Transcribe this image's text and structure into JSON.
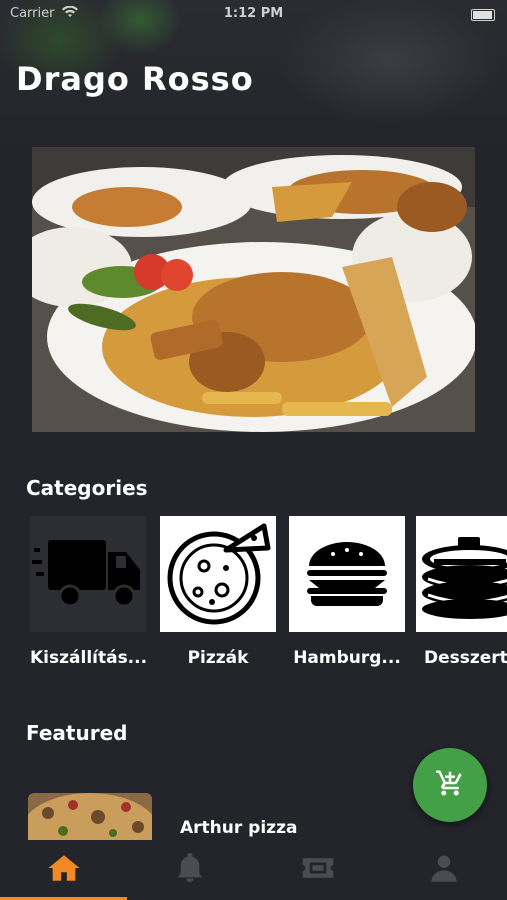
{
  "status_bar": {
    "carrier": "Carrier",
    "time": "1:12 PM"
  },
  "app": {
    "title": "Drago Rosso"
  },
  "sections": {
    "categories_title": "Categories",
    "featured_title": "Featured"
  },
  "categories": [
    {
      "label": "Kiszállítás...",
      "icon": "delivery-truck-icon"
    },
    {
      "label": "Pizzák",
      "icon": "pizza-icon"
    },
    {
      "label": "Hamburg...",
      "icon": "hamburger-icon"
    },
    {
      "label": "Desszerte",
      "icon": "pancakes-icon"
    }
  ],
  "featured": [
    {
      "name": "Arthur pizza"
    }
  ],
  "tabs": [
    {
      "name": "home-icon",
      "active": true
    },
    {
      "name": "bell-icon",
      "active": false
    },
    {
      "name": "ticket-icon",
      "active": false
    },
    {
      "name": "person-icon",
      "active": false
    }
  ],
  "colors": {
    "background": "#23252b",
    "accent": "#f08a24",
    "fab": "#43a047"
  }
}
